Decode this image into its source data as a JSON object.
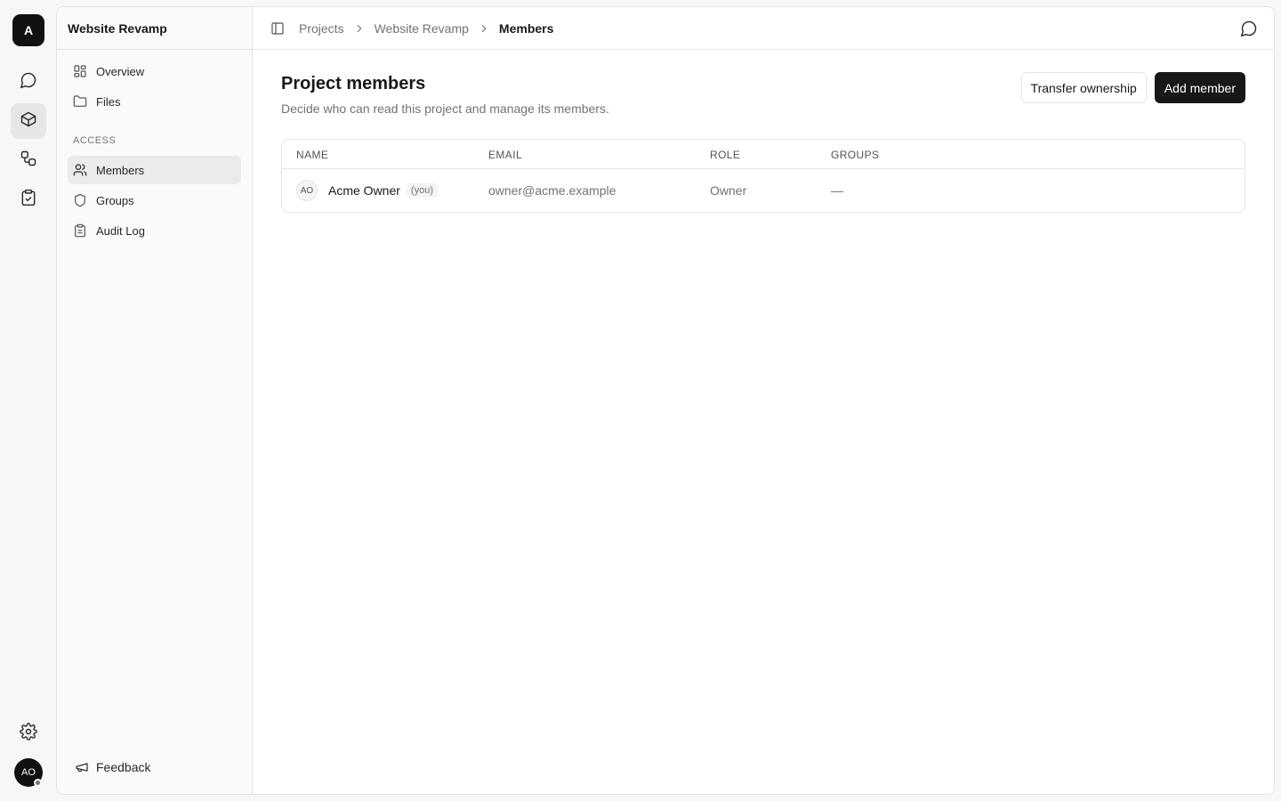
{
  "rail": {
    "logo_letter": "A",
    "items": [
      {
        "name": "chat-icon"
      },
      {
        "name": "cube-icon",
        "active": true
      },
      {
        "name": "workflow-icon"
      },
      {
        "name": "clipboard-check-icon"
      }
    ],
    "settings_icon": "gear-icon",
    "user_initials": "AO"
  },
  "sidebar": {
    "project_name": "Website Revamp",
    "items": [
      {
        "label": "Overview",
        "icon": "grid-icon"
      },
      {
        "label": "Files",
        "icon": "folder-icon"
      }
    ],
    "access_section": "ACCESS",
    "access_items": [
      {
        "label": "Members",
        "icon": "users-icon",
        "active": true
      },
      {
        "label": "Groups",
        "icon": "shield-icon"
      },
      {
        "label": "Audit Log",
        "icon": "clipboard-icon"
      }
    ],
    "feedback_label": "Feedback"
  },
  "breadcrumb": {
    "items": [
      "Projects",
      "Website Revamp",
      "Members"
    ]
  },
  "page": {
    "title": "Project members",
    "subtitle": "Decide who can read this project and manage its members.",
    "transfer_label": "Transfer ownership",
    "add_label": "Add member"
  },
  "table": {
    "columns": [
      "NAME",
      "EMAIL",
      "ROLE",
      "GROUPS"
    ],
    "rows": [
      {
        "initials": "AO",
        "name": "Acme Owner",
        "tag": "(you)",
        "email": "owner@acme.example",
        "role": "Owner",
        "groups": "—"
      }
    ]
  },
  "colors": {
    "accent": "#18181b",
    "border": "#e4e4e7",
    "muted": "#71717a",
    "background": "#f7f7f6"
  }
}
